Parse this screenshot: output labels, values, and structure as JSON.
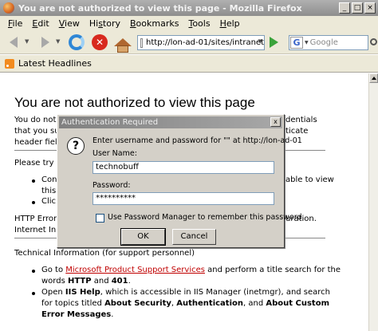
{
  "window": {
    "title": "You are not authorized to view this page - Mozilla Firefox",
    "controls": [
      "_",
      "□",
      "×"
    ]
  },
  "menu": [
    {
      "pre": "",
      "ul": "F",
      "post": "ile"
    },
    {
      "pre": "",
      "ul": "E",
      "post": "dit"
    },
    {
      "pre": "",
      "ul": "V",
      "post": "iew"
    },
    {
      "pre": "Hi",
      "ul": "s",
      "post": "tory"
    },
    {
      "pre": "",
      "ul": "B",
      "post": "ookmarks"
    },
    {
      "pre": "",
      "ul": "T",
      "post": "ools"
    },
    {
      "pre": "",
      "ul": "H",
      "post": "elp"
    }
  ],
  "toolbar": {
    "url": "http://lon-ad-01/sites/intranet",
    "search_placeholder": "Google",
    "search_engine_glyph": "G"
  },
  "bookmarks": {
    "latest_headlines": "Latest Headlines"
  },
  "page": {
    "title": "You are not authorized to view this page",
    "para1_l1_left": "You do not",
    "para1_l1_right": "dentials",
    "para1_l2_left": "that you su",
    "para1_l2_right": "ticate",
    "para1_l3_left": "header fiel",
    "please_try": "Please try",
    "bullet1_left": "Con",
    "bullet1_right": "able to view",
    "bullet1_l2": "this",
    "bullet2": "Clic",
    "http_error_left": "HTTP Error",
    "http_error_right": "uration.",
    "internet_left": "Internet In",
    "technical_info": "Technical Information (for support personnel)",
    "ti_b1_pre": "Go to ",
    "ti_b1_link": "Microsoft Product Support Services",
    "ti_b1_post": " and perform a title search for the",
    "ti_b1_l2_pre": "words ",
    "ti_b1_l2_http": "HTTP",
    "ti_b1_l2_and": " and ",
    "ti_b1_l2_401": "401",
    "ti_b1_l2_end": ".",
    "ti_b2_pre": "Open ",
    "ti_b2_iis": "IIS Help",
    "ti_b2_post": ", which is accessible in IIS Manager (inetmgr), and search",
    "ti_b2_l2_pre": "for topics titled ",
    "ti_b2_l2_sec": "About Security",
    "ti_b2_l2_comma": ", ",
    "ti_b2_l2_auth": "Authentication",
    "ti_b2_l2_and": ", and ",
    "ti_b2_l2_custom": "About Custom",
    "ti_b2_l3": "Error Messages",
    "ti_b2_l3_end": "."
  },
  "dialog": {
    "title": "Authentication Required",
    "close": "x",
    "message": "Enter username and password for \"\" at http://lon-ad-01",
    "username_label": "User Name:",
    "username_value": "technobuff",
    "password_label": "Password:",
    "password_value": "**********",
    "remember_label": "Use Password Manager to remember this password.",
    "ok": "OK",
    "cancel": "Cancel",
    "icon_glyph": "?"
  }
}
